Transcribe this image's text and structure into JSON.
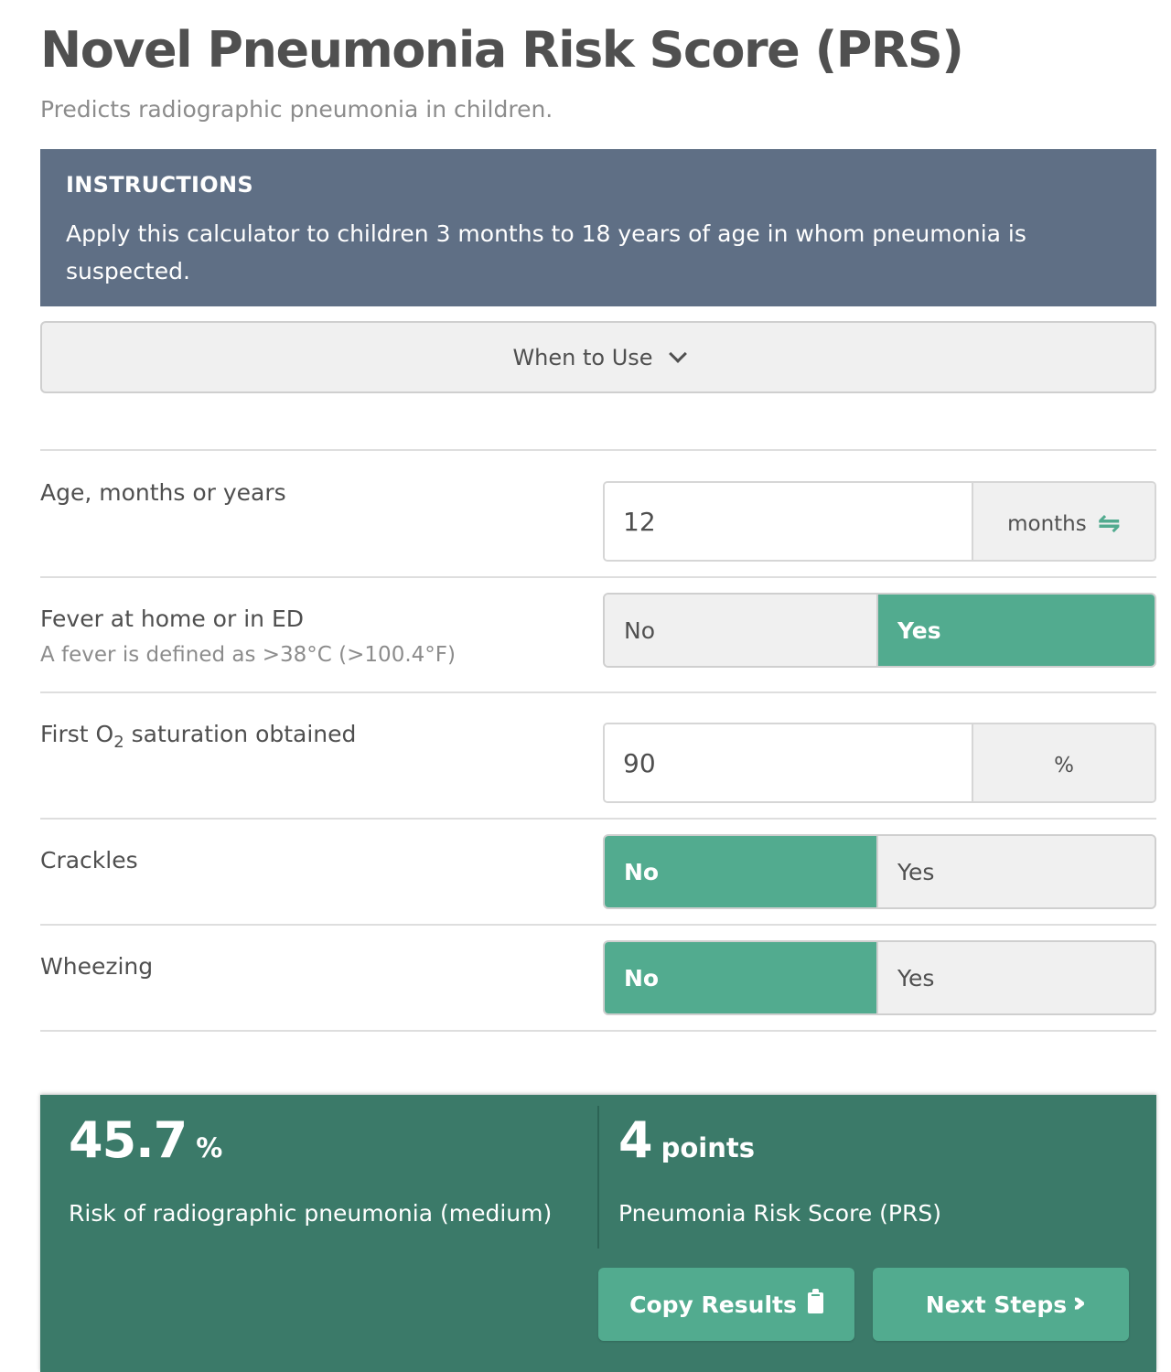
{
  "header": {
    "title": "Novel Pneumonia Risk Score (PRS)",
    "subtitle": "Predicts radiographic pneumonia in children."
  },
  "instructions": {
    "heading": "INSTRUCTIONS",
    "body": "Apply this calculator to children 3 months to 18 years of age in whom pneumonia is suspected."
  },
  "when_to_use": {
    "label": "When to Use"
  },
  "fields": {
    "age": {
      "label": "Age, months or years",
      "value": "12",
      "unit": "months",
      "unit_icon": "swap-arrows-icon"
    },
    "fever": {
      "label": "Fever at home or in ED",
      "hint": "A fever is defined as >38°C (>100.4°F)",
      "options": [
        "No",
        "Yes"
      ],
      "selected": "Yes"
    },
    "o2": {
      "label_prefix": "First O",
      "label_sub": "2",
      "label_suffix": " saturation obtained",
      "value": "90",
      "unit": "%"
    },
    "crackles": {
      "label": "Crackles",
      "options": [
        "No",
        "Yes"
      ],
      "selected": "No"
    },
    "wheezing": {
      "label": "Wheezing",
      "options": [
        "No",
        "Yes"
      ],
      "selected": "No"
    }
  },
  "results": {
    "risk": {
      "value": "45.7",
      "unit": "%",
      "label": "Risk of radiographic pneumonia (medium)"
    },
    "score": {
      "value": "4",
      "unit": "points",
      "label": "Pneumonia Risk Score (PRS)"
    },
    "copy_button": {
      "label": "Copy Results",
      "icon": "clipboard-icon"
    },
    "next_button": {
      "label": "Next Steps",
      "icon": "triple-chevron-right-icon"
    }
  },
  "colors": {
    "accent_green": "#52ab8f",
    "results_bg": "#3b7a69",
    "instructions_bg": "#5f6f85"
  }
}
